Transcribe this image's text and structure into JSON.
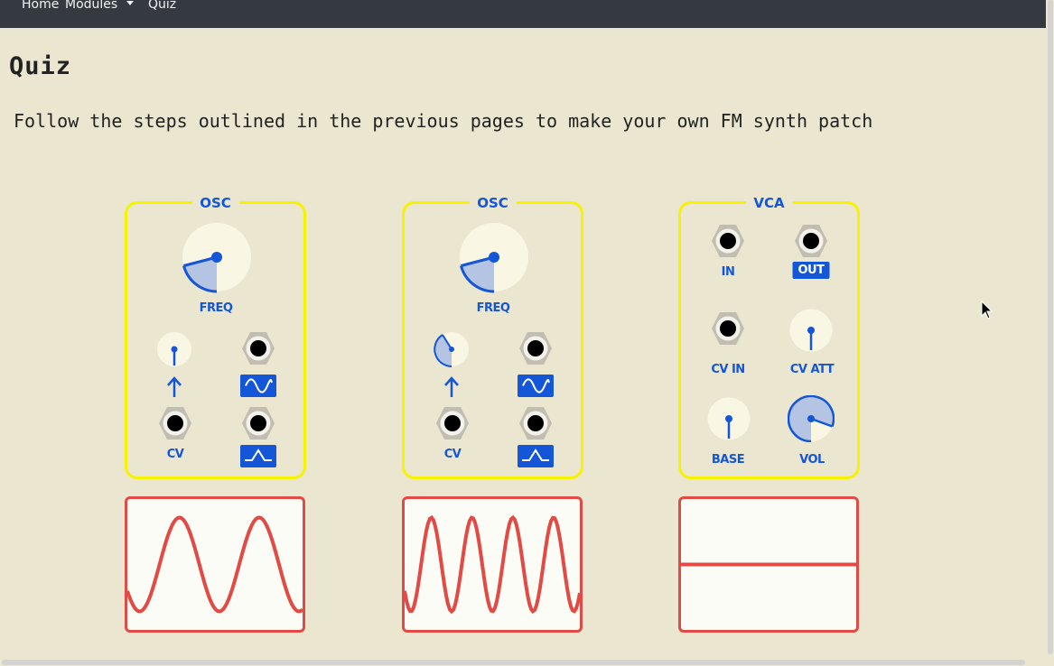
{
  "nav": {
    "home": "Home",
    "modules": "Modules",
    "quiz": "Quiz"
  },
  "page": {
    "title": "Quiz",
    "instructions": "Follow the steps outlined in the previous pages to make your own FM synth patch"
  },
  "modules": [
    {
      "title": "OSC",
      "freq_label": "FREQ",
      "freq_knob_value": 0.35,
      "fm_knob_value": 0.0,
      "cv_label": "CV",
      "sine_icon": "sine-wave-icon",
      "triangle_icon": "triangle-wave-icon",
      "arrow_icon": "arrow-up-icon"
    },
    {
      "title": "OSC",
      "freq_label": "FREQ",
      "freq_knob_value": 0.35,
      "fm_knob_value": 0.4,
      "cv_label": "CV",
      "sine_icon": "sine-wave-icon",
      "triangle_icon": "triangle-wave-icon",
      "arrow_icon": "arrow-up-icon"
    },
    {
      "title": "VCA",
      "in_label": "IN",
      "out_label": "OUT",
      "cv_in_label": "CV IN",
      "cv_att_label": "CV ATT",
      "base_label": "BASE",
      "vol_label": "VOL",
      "cv_att_value": 0.0,
      "base_value": 0.0,
      "vol_value": 0.7
    }
  ],
  "scopes": [
    {
      "signal": "sine",
      "cycles": 2.2
    },
    {
      "signal": "sine",
      "cycles": 4.3
    },
    {
      "signal": "flat",
      "cycles": 0
    }
  ],
  "colors": {
    "background": "#eae6d0",
    "navbar": "#343a40",
    "module_border": "#f7f200",
    "accent_blue": "#1456d8",
    "scope_red": "#e24a45",
    "knob_face": "#f9f6e4"
  }
}
